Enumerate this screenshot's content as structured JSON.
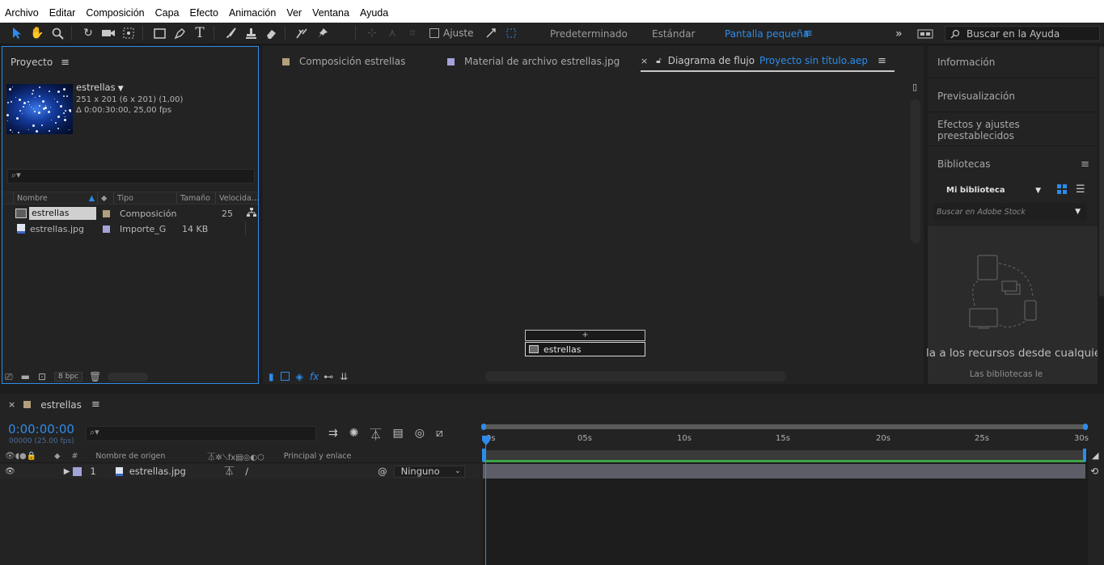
{
  "menu": [
    "Archivo",
    "Editar",
    "Composición",
    "Capa",
    "Efecto",
    "Animación",
    "Ver",
    "Ventana",
    "Ayuda"
  ],
  "toolbar": {
    "snap_label": "Ajuste",
    "workspaces": [
      "Predeterminado",
      "Estándar",
      "Pantalla pequeña"
    ],
    "active_workspace": "Pantalla pequeña",
    "help_search_placeholder": "Buscar en la Ayuda",
    "more": "»"
  },
  "project": {
    "title": "Proyecto",
    "comp_name": "estrellas",
    "comp_dims": "251 x 201  (6 x 201) (1,00)",
    "comp_duration": "Δ 0:00:30:00, 25,00 fps",
    "search_placeholder": "",
    "columns": [
      "Nombre",
      "Tipo",
      "Tamaño",
      "Velocida…"
    ],
    "items": [
      {
        "name": "estrellas",
        "type": "Composición",
        "size": "",
        "fps": "25",
        "color": "#b29f7b",
        "selected": true
      },
      {
        "name": "estrellas.jpg",
        "type": "Importe_G",
        "size": "14 KB",
        "fps": "",
        "color": "#a4a3d8",
        "selected": false
      }
    ],
    "bpc": "8 bpc"
  },
  "tabs": [
    {
      "label": "Composición  estrellas",
      "color": "#b29f7b"
    },
    {
      "label": "Material de archivo  estrellas.jpg",
      "color": "#a4a3d8"
    },
    {
      "label": "Diagrama de flujo",
      "link": "Proyecto sin título.aep"
    }
  ],
  "flowchart": {
    "node_label": "estrellas",
    "plus": "+"
  },
  "right_panel": {
    "sections": [
      "Información",
      "Previsualización",
      "Efectos y ajustes preestablecidos",
      "Bibliotecas"
    ],
    "library": "Mi biblioteca",
    "stock_placeholder": "Buscar en Adobe Stock",
    "promo_title": "la a los recursos desde cualquie",
    "promo_sub": "Las bibliotecas le"
  },
  "timeline": {
    "tab_label": "estrellas",
    "timecode": "0:00:00:00",
    "timecode_sub": "00000 (25.00 fps)",
    "search_placeholder": "",
    "header_source": "Nombre de origen",
    "header_parent": "Principal y enlace",
    "hash": "#",
    "layer": {
      "num": "1",
      "name": "estrellas.jpg",
      "parent": "Ninguno"
    },
    "ruler": [
      "0s",
      "05s",
      "10s",
      "15s",
      "20s",
      "25s",
      "30s"
    ]
  }
}
